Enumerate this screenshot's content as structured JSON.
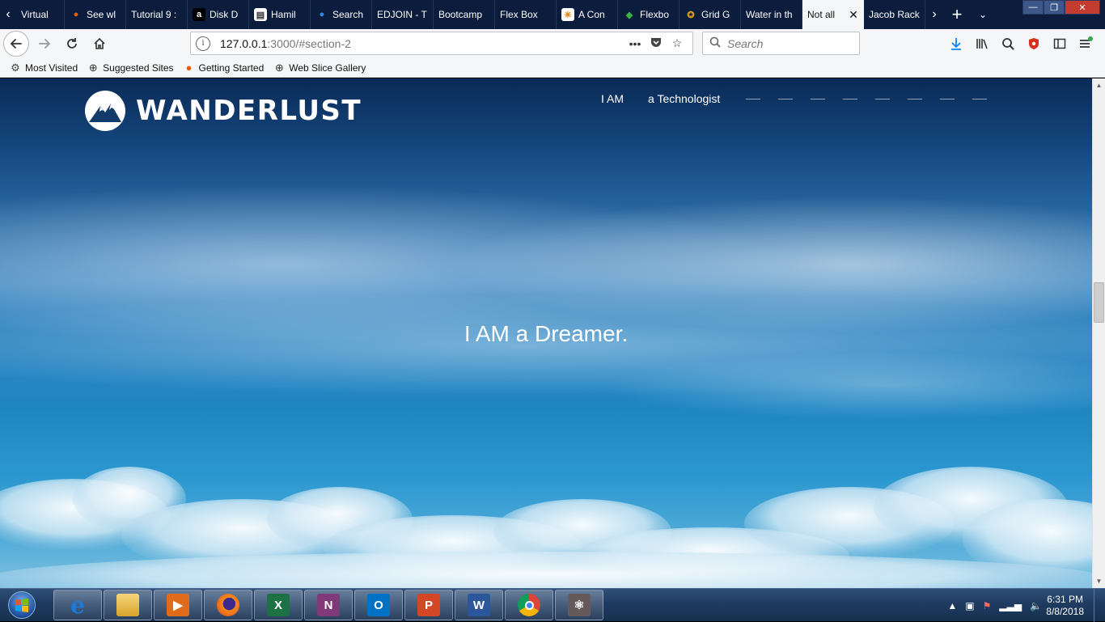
{
  "browser": {
    "tabs": [
      {
        "label": "Virtual",
        "icon": "chevron-icon",
        "active": false
      },
      {
        "label": "See wl",
        "icon": "firefox-icon",
        "active": false
      },
      {
        "label": "Tutorial 9 :",
        "icon": "",
        "active": false
      },
      {
        "label": "Disk D",
        "icon": "amazon-icon",
        "active": false
      },
      {
        "label": "Hamil",
        "icon": "document-icon",
        "active": false
      },
      {
        "label": "Search",
        "icon": "globe-icon",
        "active": false
      },
      {
        "label": "EDJOIN - T",
        "icon": "",
        "active": false
      },
      {
        "label": "Bootcamp",
        "icon": "",
        "active": false
      },
      {
        "label": "Flex Box",
        "icon": "",
        "active": false
      },
      {
        "label": "A Con",
        "icon": "asterisk-icon",
        "active": false
      },
      {
        "label": "Flexbo",
        "icon": "frog-icon",
        "active": false
      },
      {
        "label": "Grid G",
        "icon": "medal-icon",
        "active": false
      },
      {
        "label": "Water in th",
        "icon": "",
        "active": false
      },
      {
        "label": "Not all",
        "icon": "",
        "active": true
      },
      {
        "label": "Jacob Rack",
        "icon": "",
        "active": false
      }
    ],
    "url": {
      "host": "127.0.0.1",
      "rest": ":3000/#section-2"
    },
    "search_placeholder": "Search",
    "bookmarks": [
      {
        "label": "Most Visited",
        "icon": "gear-icon"
      },
      {
        "label": "Suggested Sites",
        "icon": "globe-icon"
      },
      {
        "label": "Getting Started",
        "icon": "firefox-icon"
      },
      {
        "label": "Web Slice Gallery",
        "icon": "globe-icon"
      }
    ]
  },
  "site": {
    "logo_text": "WANDERLUST",
    "nav": [
      "I AM",
      "a Technologist"
    ],
    "hero_text": "I AM a Dreamer."
  },
  "taskbar": {
    "apps": [
      {
        "name": "internet-explorer",
        "letter": "e",
        "color": "#1a7bd6"
      },
      {
        "name": "file-explorer",
        "letter": "",
        "color": "#e8b53a"
      },
      {
        "name": "media-player",
        "letter": "▶",
        "color": "#e06b1b"
      },
      {
        "name": "firefox",
        "letter": "",
        "color": "#e66000"
      },
      {
        "name": "excel",
        "letter": "X",
        "color": "#1e7145"
      },
      {
        "name": "onenote",
        "letter": "N",
        "color": "#80397b"
      },
      {
        "name": "outlook",
        "letter": "O",
        "color": "#0072c6"
      },
      {
        "name": "powerpoint",
        "letter": "P",
        "color": "#d24726"
      },
      {
        "name": "word",
        "letter": "W",
        "color": "#2b579a"
      },
      {
        "name": "chrome",
        "letter": "",
        "color": "#4285f4"
      },
      {
        "name": "atom",
        "letter": "⚛",
        "color": "#66595c"
      }
    ],
    "time": "6:31 PM",
    "date": "8/8/2018"
  },
  "colors": {
    "sky_dark": "#0b2a55",
    "sky_mid": "#2f86c2",
    "sky_light": "#7fc0e1",
    "tabstrip": "#0c1c3c",
    "taskbar": "#1f3b61"
  }
}
